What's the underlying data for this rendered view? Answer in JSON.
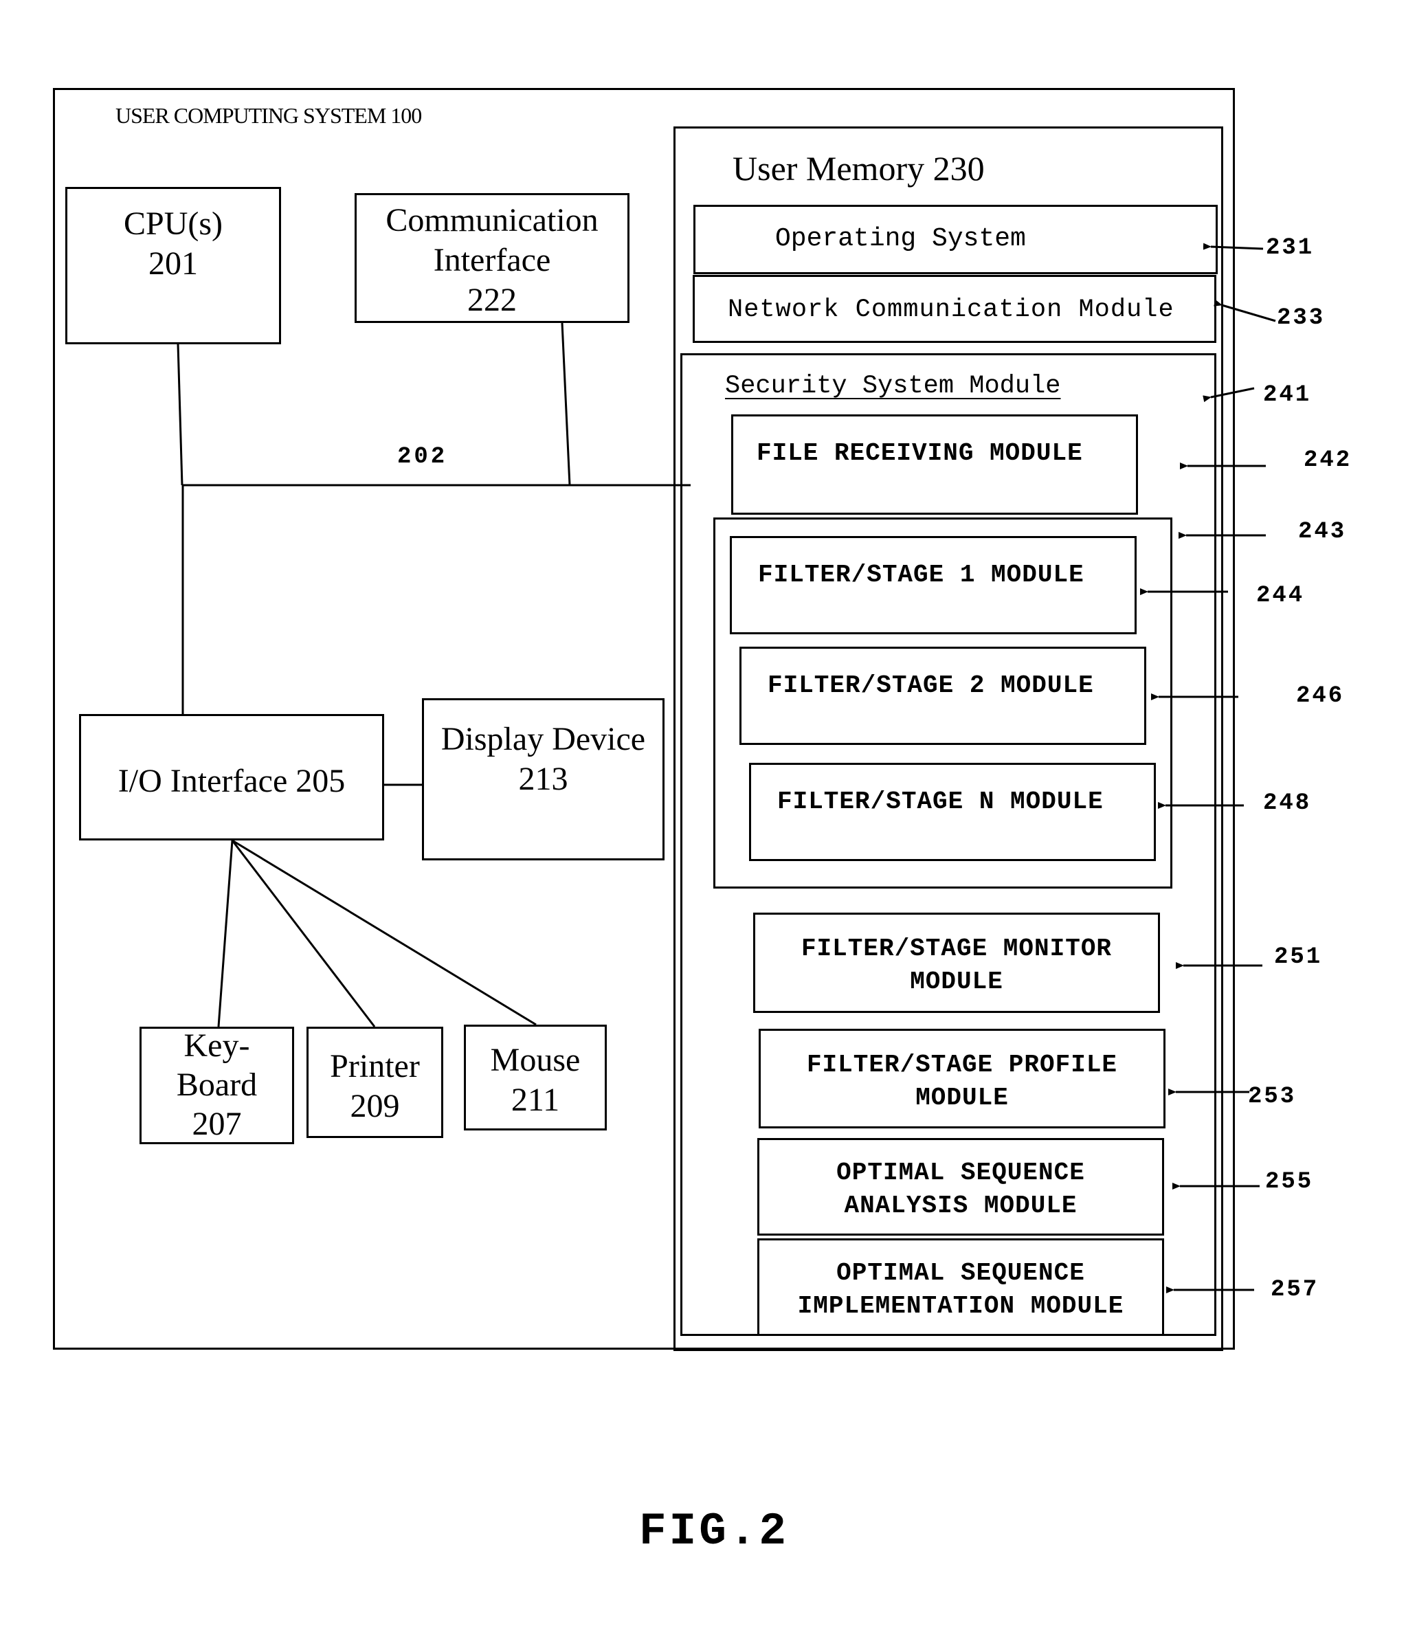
{
  "figure": {
    "caption": "FIG.2",
    "system_title": "USER COMPUTING SYSTEM 100",
    "bus_label": "202"
  },
  "hardware": {
    "cpu": "CPU(s)\n201",
    "communication_interface": "Communication\nInterface\n222",
    "io_interface": "I/O Interface 205",
    "display_device": "Display Device\n213",
    "keyboard": "Key-\nBoard\n207",
    "printer": "Printer\n209",
    "mouse": "Mouse\n211"
  },
  "memory": {
    "title": "User Memory 230",
    "operating_system": "Operating System",
    "network_module": "Network Communication Module",
    "security": {
      "title": "Security System Module",
      "file_receiving": "FILE RECEIVING MODULE",
      "stage_1": "FILTER/STAGE 1 MODULE",
      "stage_2": "FILTER/STAGE 2 MODULE",
      "stage_n": "FILTER/STAGE N MODULE",
      "monitor": "FILTER/STAGE MONITOR\nMODULE",
      "profile": "FILTER/STAGE PROFILE\nMODULE",
      "analysis": "OPTIMAL SEQUENCE\nANALYSIS MODULE",
      "implementation": "OPTIMAL SEQUENCE\nIMPLEMENTATION MODULE"
    }
  },
  "reference_numerals": {
    "r231": "231",
    "r233": "233",
    "r241": "241",
    "r242": "242",
    "r243": "243",
    "r244": "244",
    "r246": "246",
    "r248": "248",
    "r251": "251",
    "r253": "253",
    "r255": "255",
    "r257": "257"
  }
}
